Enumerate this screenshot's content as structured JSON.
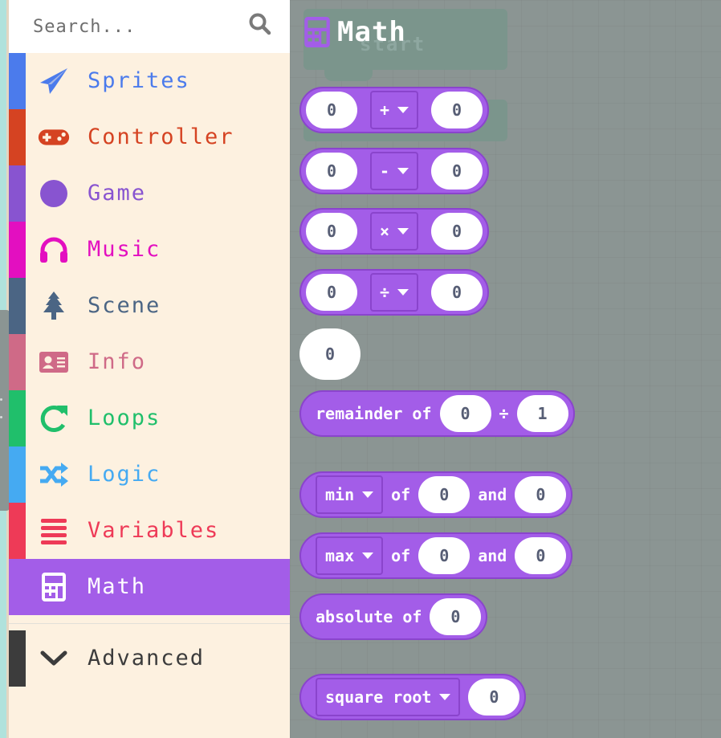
{
  "search": {
    "placeholder": "Search..."
  },
  "categories": [
    {
      "id": "sprites",
      "label": "Sprites",
      "icon": "paper-plane-icon",
      "color": "#4b7bec"
    },
    {
      "id": "controller",
      "label": "Controller",
      "icon": "gamepad-icon",
      "color": "#d54322"
    },
    {
      "id": "game",
      "label": "Game",
      "icon": "circle-icon",
      "color": "#8854d0"
    },
    {
      "id": "music",
      "label": "Music",
      "icon": "headphones-icon",
      "color": "#e30fc0"
    },
    {
      "id": "scene",
      "label": "Scene",
      "icon": "tree-icon",
      "color": "#4b6584"
    },
    {
      "id": "info",
      "label": "Info",
      "icon": "id-card-icon",
      "color": "#cf6a87"
    },
    {
      "id": "loops",
      "label": "Loops",
      "icon": "redo-icon",
      "color": "#20bf6b"
    },
    {
      "id": "logic",
      "label": "Logic",
      "icon": "shuffle-icon",
      "color": "#45aaf2"
    },
    {
      "id": "variables",
      "label": "Variables",
      "icon": "list-icon",
      "color": "#ee3a57"
    },
    {
      "id": "math",
      "label": "Math",
      "icon": "calculator-icon",
      "color": "#a35de8",
      "selected": true
    }
  ],
  "advanced": {
    "label": "Advanced",
    "icon": "chevron-down-icon",
    "color": "#3c3c3c"
  },
  "flyout": {
    "title": "Math",
    "ghost_label": "start",
    "arith_blocks": [
      {
        "left": "0",
        "op": "+",
        "right": "0"
      },
      {
        "left": "0",
        "op": "-",
        "right": "0"
      },
      {
        "left": "0",
        "op": "×",
        "right": "0"
      },
      {
        "left": "0",
        "op": "÷",
        "right": "0"
      }
    ],
    "number_block": "0",
    "remainder": {
      "label": "remainder of",
      "a": "0",
      "op": "÷",
      "b": "1"
    },
    "min": {
      "fn": "min",
      "of": "of",
      "a": "0",
      "and": "and",
      "b": "0"
    },
    "max": {
      "fn": "max",
      "of": "of",
      "a": "0",
      "and": "and",
      "b": "0"
    },
    "absolute": {
      "label": "absolute of",
      "value": "0"
    },
    "sqrt": {
      "fn": "square root",
      "value": "0"
    }
  }
}
